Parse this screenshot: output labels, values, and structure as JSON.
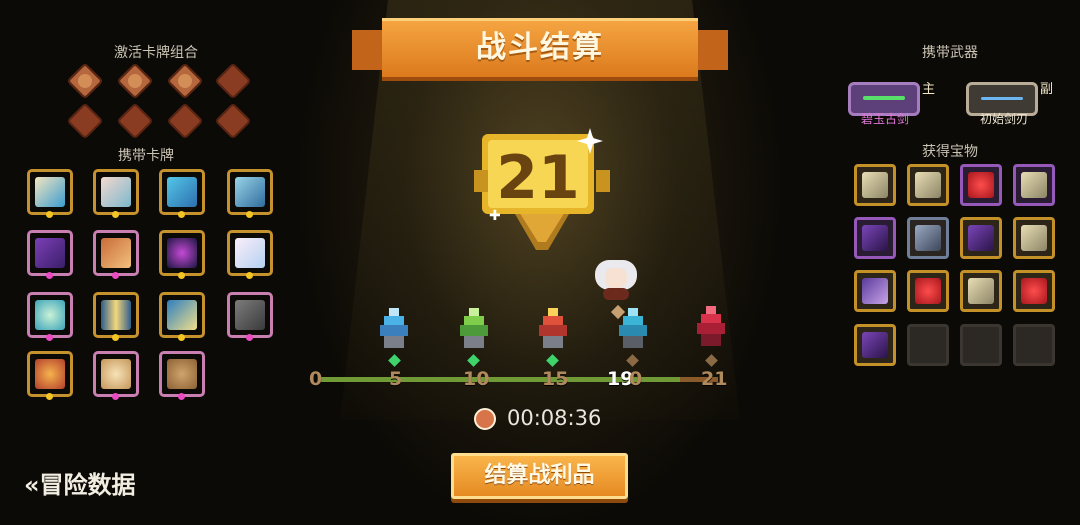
{
  "left_panel": {
    "combos_title": "激活卡牌组合",
    "cards_title": "携带卡牌"
  },
  "right_panel": {
    "weapons_title": "携带武器",
    "main_tag": "主",
    "sub_tag": "副",
    "weapon_main_name": "碧玉古剑",
    "weapon_sub_name": "初始剑刃",
    "treasures_title": "获得宝物"
  },
  "banner": {
    "title": "战斗结算"
  },
  "score": {
    "value": "21"
  },
  "progress": {
    "ticks": [
      "0",
      "5",
      "10",
      "15",
      "19",
      "0",
      "21"
    ],
    "current": 19,
    "max": 21
  },
  "timer": {
    "value": "00:08:36"
  },
  "actions": {
    "claim_label": "结算战利品",
    "back_label": "«冒险数据"
  },
  "colors": {
    "accent": "#e58a22",
    "gold": "#f3c423",
    "track_green": "#6f9a35",
    "track_brown": "#8a5a2a"
  }
}
